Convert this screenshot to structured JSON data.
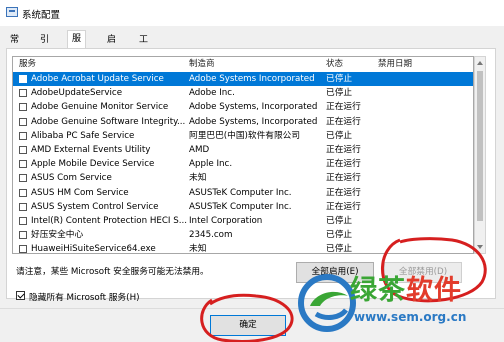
{
  "window": {
    "title": "系统配置"
  },
  "tabs": [
    {
      "label": "常规"
    },
    {
      "label": "引导"
    },
    {
      "label": "服务"
    },
    {
      "label": "启动"
    },
    {
      "label": "工具"
    }
  ],
  "active_tab": "服务",
  "table": {
    "columns": [
      "服务",
      "制造商",
      "状态",
      "禁用日期"
    ],
    "rows": [
      {
        "name": "Adobe Acrobat Update Service",
        "manufacturer": "Adobe Systems Incorporated",
        "status": "已停止",
        "selected": true
      },
      {
        "name": "AdobeUpdateService",
        "manufacturer": "Adobe Inc.",
        "status": "已停止"
      },
      {
        "name": "Adobe Genuine Monitor Service",
        "manufacturer": "Adobe Systems, Incorporated",
        "status": "正在运行"
      },
      {
        "name": "Adobe Genuine Software Integrity...",
        "manufacturer": "Adobe Systems, Incorporated",
        "status": "正在运行"
      },
      {
        "name": "Alibaba PC Safe Service",
        "manufacturer": "阿里巴巴(中国)软件有限公司",
        "status": "已停止"
      },
      {
        "name": "AMD External Events Utility",
        "manufacturer": "AMD",
        "status": "正在运行"
      },
      {
        "name": "Apple Mobile Device Service",
        "manufacturer": "Apple Inc.",
        "status": "正在运行"
      },
      {
        "name": "ASUS Com Service",
        "manufacturer": "未知",
        "status": "正在运行"
      },
      {
        "name": "ASUS HM Com Service",
        "manufacturer": "ASUSTeK Computer Inc.",
        "status": "正在运行"
      },
      {
        "name": "ASUS System Control Service",
        "manufacturer": "ASUSTeK Computer Inc.",
        "status": "正在运行"
      },
      {
        "name": "Intel(R) Content Protection HECI S...",
        "manufacturer": "Intel Corporation",
        "status": "已停止"
      },
      {
        "name": "好压安全中心",
        "manufacturer": "2345.com",
        "status": "已停止"
      },
      {
        "name": "HuaweiHiSuiteService64.exe",
        "manufacturer": "未知",
        "status": "已停止"
      }
    ]
  },
  "note": "请注意，某些 Microsoft 安全服务可能无法禁用。",
  "buttons": {
    "enable_all": "全部启用(E)",
    "disable_all": "全部禁用(D)",
    "ok": "确定"
  },
  "hide_ms": {
    "label": "隐藏所有 Microsoft 服务(H)",
    "checked": true
  },
  "watermark": {
    "text_green": "绿茶",
    "text_red": "软件",
    "url": "www.sem.org.cn"
  },
  "colors": {
    "selection": "#0078d7",
    "annotation": "#d61f1f",
    "wm_green": "#3aa635",
    "wm_blue": "#2a79c4"
  }
}
